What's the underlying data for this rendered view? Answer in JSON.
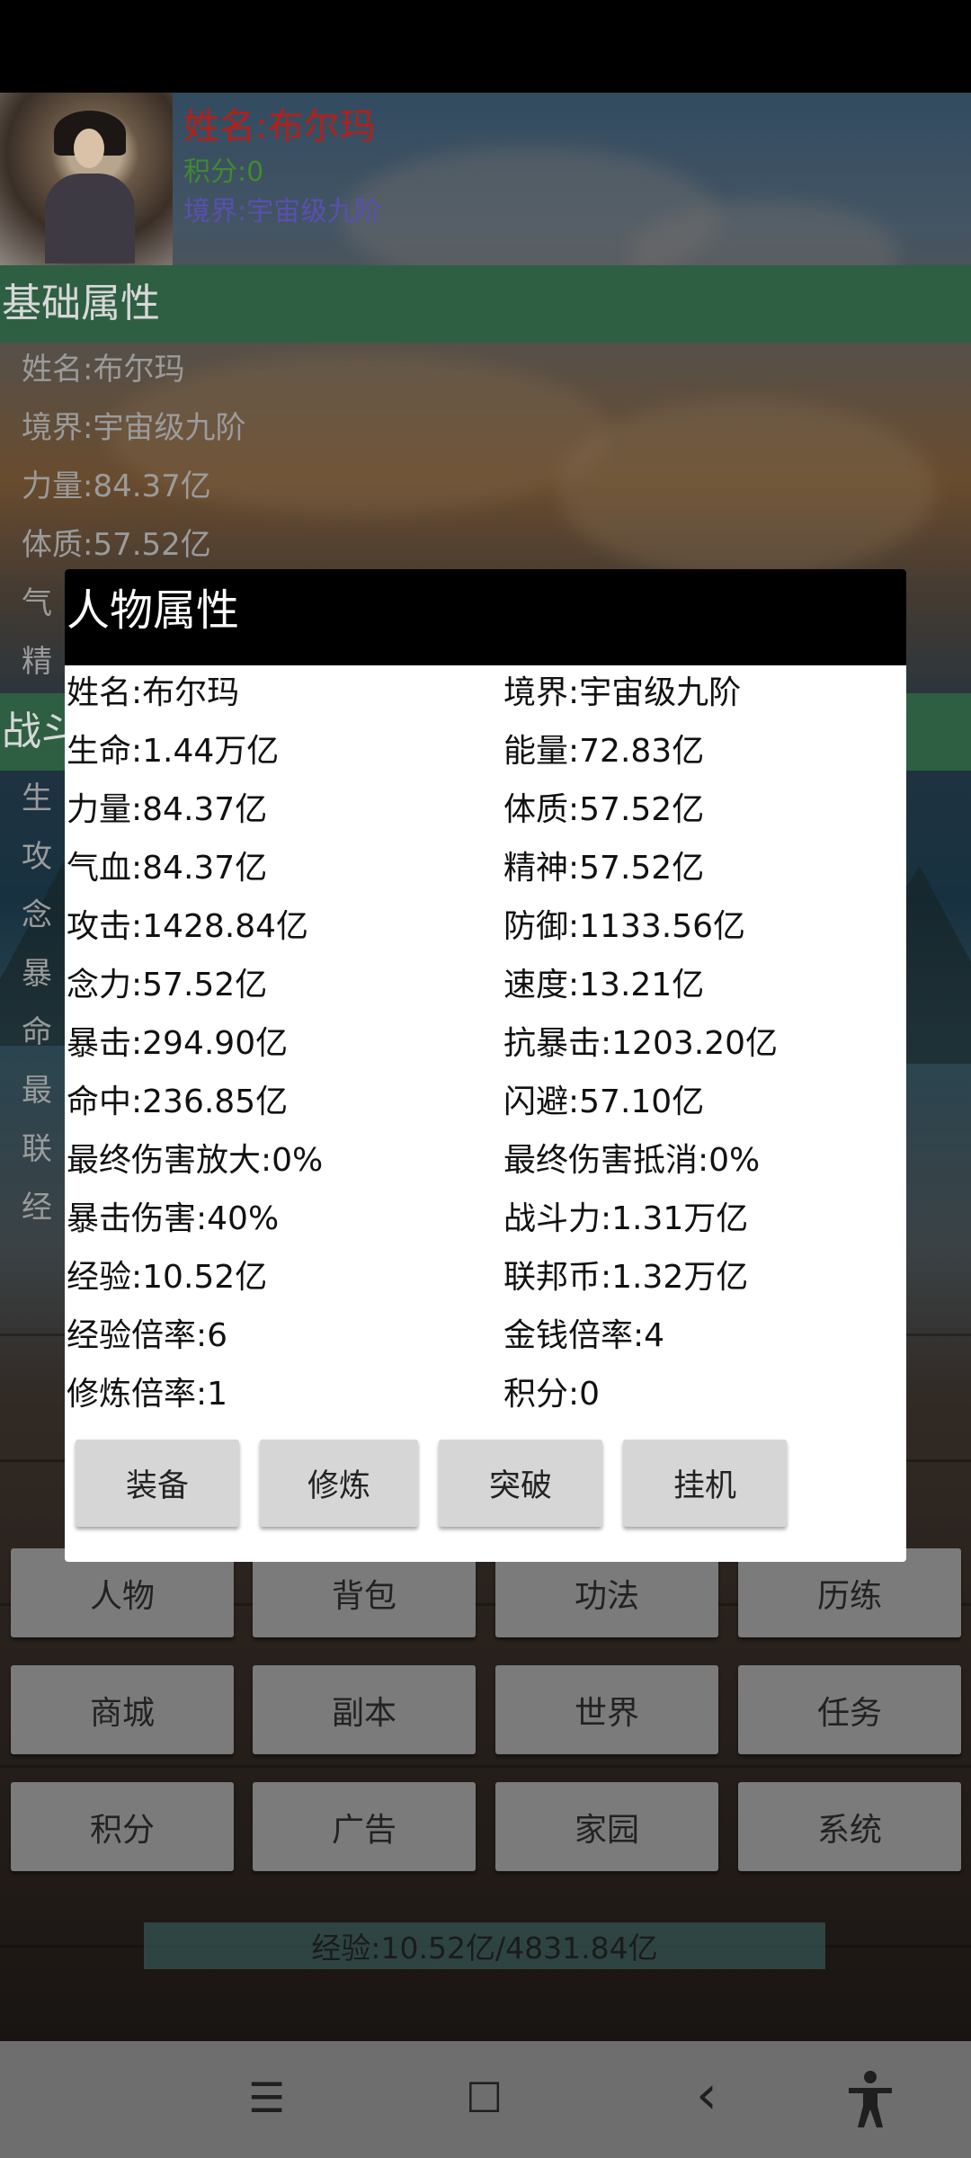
{
  "header": {
    "name": "姓名:布尔玛",
    "score": "积分:0",
    "realm": "境界:宇宙级九阶"
  },
  "sections": {
    "basic_title": "基础属性",
    "battle_title": "战斗",
    "basic_lines": [
      "姓名:布尔玛",
      "境界:宇宙级九阶",
      "力量:84.37亿",
      "体质:57.52亿",
      "气",
      "精"
    ],
    "battle_lines": [
      "生",
      "攻",
      "念",
      "暴",
      "命",
      "最",
      "联",
      "经"
    ]
  },
  "dialog": {
    "title": "人物属性",
    "left": [
      "姓名:布尔玛",
      "生命:1.44万亿",
      "力量:84.37亿",
      "气血:84.37亿",
      "攻击:1428.84亿",
      "念力:57.52亿",
      "暴击:294.90亿",
      "命中:236.85亿",
      "最终伤害放大:0%",
      "暴击伤害:40%",
      "经验:10.52亿",
      "经验倍率:6",
      "修炼倍率:1"
    ],
    "right": [
      "境界:宇宙级九阶",
      "能量:72.83亿",
      "体质:57.52亿",
      "精神:57.52亿",
      "防御:1133.56亿",
      "速度:13.21亿",
      "抗暴击:1203.20亿",
      "闪避:57.10亿",
      "最终伤害抵消:0%",
      "战斗力:1.31万亿",
      "联邦币:1.32万亿",
      "金钱倍率:4",
      "积分:0"
    ],
    "buttons": [
      "装备",
      "修炼",
      "突破",
      "挂机"
    ]
  },
  "menu": {
    "rows": [
      [
        "人物",
        "背包",
        "功法",
        "历练"
      ],
      [
        "商城",
        "副本",
        "世界",
        "任务"
      ],
      [
        "积分",
        "广告",
        "家园",
        "系统"
      ]
    ]
  },
  "exp_bar": "经验:10.52亿/4831.84亿",
  "nav": {
    "menu_icon": "☰",
    "home_icon": "☐",
    "back_icon": "‹",
    "accessibility_icon": "accessibility"
  },
  "colors": {
    "name_red": "#b3201a",
    "score_green": "#3f8a2d",
    "realm_purple": "#5a4fb0",
    "section_green": "#2e5f43"
  }
}
